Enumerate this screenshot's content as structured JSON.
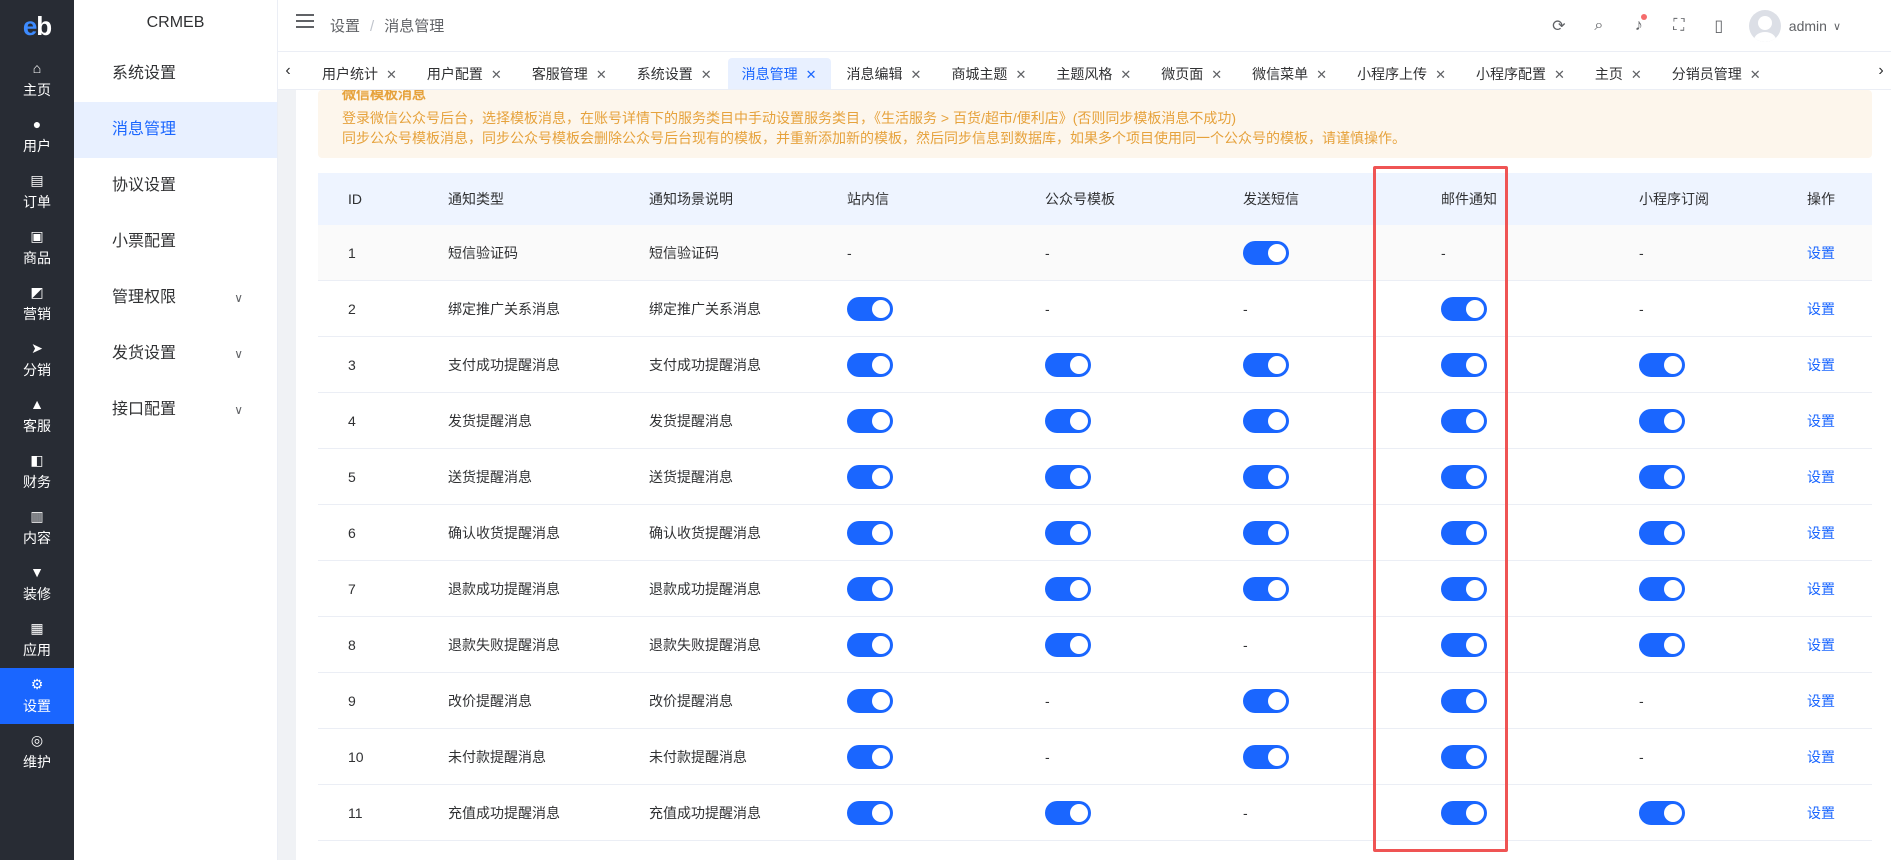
{
  "rail": {
    "logo": "eb",
    "items": [
      {
        "label": "主页",
        "icon": "home-icon",
        "glyph": "⌂"
      },
      {
        "label": "用户",
        "icon": "user-icon",
        "glyph": "●"
      },
      {
        "label": "订单",
        "icon": "order-icon",
        "glyph": "▤"
      },
      {
        "label": "商品",
        "icon": "goods-icon",
        "glyph": "▣"
      },
      {
        "label": "营销",
        "icon": "marketing-icon",
        "glyph": "◩"
      },
      {
        "label": "分销",
        "icon": "distribution-icon",
        "glyph": "➤"
      },
      {
        "label": "客服",
        "icon": "service-icon",
        "glyph": "▲"
      },
      {
        "label": "财务",
        "icon": "finance-icon",
        "glyph": "◧"
      },
      {
        "label": "内容",
        "icon": "content-icon",
        "glyph": "▥"
      },
      {
        "label": "装修",
        "icon": "decorate-icon",
        "glyph": "▼"
      },
      {
        "label": "应用",
        "icon": "apps-icon",
        "glyph": "▦"
      },
      {
        "label": "设置",
        "icon": "settings-icon",
        "glyph": "⚙"
      },
      {
        "label": "维护",
        "icon": "maintain-icon",
        "glyph": "◎"
      }
    ],
    "active_index": 11
  },
  "submenu": {
    "title": "CRMEB",
    "items": [
      {
        "label": "系统设置",
        "has_chevron": false
      },
      {
        "label": "消息管理",
        "has_chevron": false
      },
      {
        "label": "协议设置",
        "has_chevron": false
      },
      {
        "label": "小票配置",
        "has_chevron": false
      },
      {
        "label": "管理权限",
        "has_chevron": true
      },
      {
        "label": "发货设置",
        "has_chevron": true
      },
      {
        "label": "接口配置",
        "has_chevron": true
      }
    ],
    "active_index": 1
  },
  "header": {
    "breadcrumb": [
      "设置",
      "消息管理"
    ],
    "user_name": "admin"
  },
  "tabs": {
    "items": [
      "用户统计",
      "用户配置",
      "客服管理",
      "系统设置",
      "消息管理",
      "消息编辑",
      "商城主题",
      "主题风格",
      "微页面",
      "微信菜单",
      "小程序上传",
      "小程序配置",
      "主页",
      "分销员管理"
    ],
    "active_index": 4
  },
  "alert": {
    "line0": "微信模板消息",
    "line1": "登录微信公众号后台，选择模板消息，在账号详情下的服务类目中手动设置服务类目，《生活服务 > 百货/超市/便利店》(否则同步模板消息不成功)",
    "line2": "同步公众号模板消息，同步公众号模板会删除公众号后台现有的模板，并重新添加新的模板，然后同步信息到数据库，如果多个项目使用同一个公众号的模板，请谨慎操作。"
  },
  "table": {
    "columns": [
      "ID",
      "通知类型",
      "通知场景说明",
      "站内信",
      "公众号模板",
      "发送短信",
      "邮件通知",
      "小程序订阅",
      "操作"
    ],
    "rows": [
      {
        "id": "1",
        "type": "短信验证码",
        "scene": "短信验证码",
        "site": "-",
        "wx": "-",
        "sms": "on",
        "mail": "-",
        "mini": "-",
        "op": "设置"
      },
      {
        "id": "2",
        "type": "绑定推广关系消息",
        "scene": "绑定推广关系消息",
        "site": "on",
        "wx": "-",
        "sms": "-",
        "mail": "on",
        "mini": "-",
        "op": "设置"
      },
      {
        "id": "3",
        "type": "支付成功提醒消息",
        "scene": "支付成功提醒消息",
        "site": "on",
        "wx": "on",
        "sms": "on",
        "mail": "on",
        "mini": "on",
        "op": "设置"
      },
      {
        "id": "4",
        "type": "发货提醒消息",
        "scene": "发货提醒消息",
        "site": "on",
        "wx": "on",
        "sms": "on",
        "mail": "on",
        "mini": "on",
        "op": "设置"
      },
      {
        "id": "5",
        "type": "送货提醒消息",
        "scene": "送货提醒消息",
        "site": "on",
        "wx": "on",
        "sms": "on",
        "mail": "on",
        "mini": "on",
        "op": "设置"
      },
      {
        "id": "6",
        "type": "确认收货提醒消息",
        "scene": "确认收货提醒消息",
        "site": "on",
        "wx": "on",
        "sms": "on",
        "mail": "on",
        "mini": "on",
        "op": "设置"
      },
      {
        "id": "7",
        "type": "退款成功提醒消息",
        "scene": "退款成功提醒消息",
        "site": "on",
        "wx": "on",
        "sms": "on",
        "mail": "on",
        "mini": "on",
        "op": "设置"
      },
      {
        "id": "8",
        "type": "退款失败提醒消息",
        "scene": "退款失败提醒消息",
        "site": "on",
        "wx": "on",
        "sms": "-",
        "mail": "on",
        "mini": "on",
        "op": "设置"
      },
      {
        "id": "9",
        "type": "改价提醒消息",
        "scene": "改价提醒消息",
        "site": "on",
        "wx": "-",
        "sms": "on",
        "mail": "on",
        "mini": "-",
        "op": "设置"
      },
      {
        "id": "10",
        "type": "未付款提醒消息",
        "scene": "未付款提醒消息",
        "site": "on",
        "wx": "-",
        "sms": "on",
        "mail": "on",
        "mini": "-",
        "op": "设置"
      },
      {
        "id": "11",
        "type": "充值成功提醒消息",
        "scene": "充值成功提醒消息",
        "site": "on",
        "wx": "on",
        "sms": "-",
        "mail": "on",
        "mini": "on",
        "op": "设置"
      }
    ]
  },
  "colors": {
    "accent": "#1a66ff",
    "rail_bg": "#282c34",
    "highlight": "#ef5454",
    "warning": "#e6a23c"
  }
}
